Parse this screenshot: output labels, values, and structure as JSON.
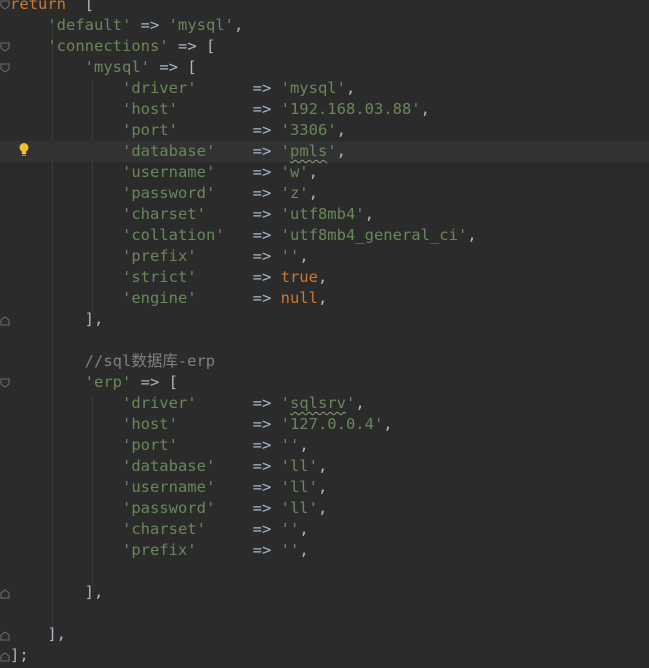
{
  "code_lines": [
    {
      "type": "plain",
      "parts": [
        {
          "c": "kw",
          "t": "return"
        },
        {
          "c": "op",
          "t": "  ["
        }
      ]
    },
    {
      "type": "plain",
      "parts": [
        {
          "c": "op",
          "t": "    "
        },
        {
          "c": "str",
          "t": "'default'"
        },
        {
          "c": "op",
          "t": " => "
        },
        {
          "c": "str",
          "t": "'mysql'"
        },
        {
          "c": "op",
          "t": ","
        }
      ]
    },
    {
      "type": "plain",
      "parts": [
        {
          "c": "op",
          "t": "    "
        },
        {
          "c": "str",
          "t": "'connections'"
        },
        {
          "c": "op",
          "t": " => ["
        }
      ]
    },
    {
      "type": "plain",
      "parts": [
        {
          "c": "op",
          "t": "        "
        },
        {
          "c": "str",
          "t": "'mysql'"
        },
        {
          "c": "op",
          "t": " => ["
        }
      ]
    },
    {
      "type": "plain",
      "parts": [
        {
          "c": "op",
          "t": "            "
        },
        {
          "c": "str",
          "t": "'driver'"
        },
        {
          "c": "op",
          "t": "      => "
        },
        {
          "c": "str",
          "t": "'mysql'"
        },
        {
          "c": "op",
          "t": ","
        }
      ]
    },
    {
      "type": "plain",
      "parts": [
        {
          "c": "op",
          "t": "            "
        },
        {
          "c": "str",
          "t": "'host'"
        },
        {
          "c": "op",
          "t": "        => "
        },
        {
          "c": "str",
          "t": "'192.168.03.88'"
        },
        {
          "c": "op",
          "t": ","
        }
      ]
    },
    {
      "type": "plain",
      "parts": [
        {
          "c": "op",
          "t": "            "
        },
        {
          "c": "str",
          "t": "'port'"
        },
        {
          "c": "op",
          "t": "        => "
        },
        {
          "c": "str",
          "t": "'3306'"
        },
        {
          "c": "op",
          "t": ","
        }
      ]
    },
    {
      "type": "current",
      "parts": [
        {
          "c": "op",
          "t": "            "
        },
        {
          "c": "str",
          "t": "'database'"
        },
        {
          "c": "op",
          "t": "    => "
        },
        {
          "c": "str",
          "t": "'"
        },
        {
          "c": "str squig",
          "t": "pmls"
        },
        {
          "c": "str",
          "t": "'"
        },
        {
          "c": "op",
          "t": ","
        }
      ]
    },
    {
      "type": "plain",
      "parts": [
        {
          "c": "op",
          "t": "            "
        },
        {
          "c": "str",
          "t": "'username'"
        },
        {
          "c": "op",
          "t": "    => "
        },
        {
          "c": "str",
          "t": "'w'"
        },
        {
          "c": "op",
          "t": ","
        }
      ]
    },
    {
      "type": "plain",
      "parts": [
        {
          "c": "op",
          "t": "            "
        },
        {
          "c": "str",
          "t": "'password'"
        },
        {
          "c": "op",
          "t": "    => "
        },
        {
          "c": "str",
          "t": "'z'"
        },
        {
          "c": "op",
          "t": ","
        }
      ]
    },
    {
      "type": "plain",
      "parts": [
        {
          "c": "op",
          "t": "            "
        },
        {
          "c": "str",
          "t": "'charset'"
        },
        {
          "c": "op",
          "t": "     => "
        },
        {
          "c": "str",
          "t": "'utf8mb4'"
        },
        {
          "c": "op",
          "t": ","
        }
      ]
    },
    {
      "type": "plain",
      "parts": [
        {
          "c": "op",
          "t": "            "
        },
        {
          "c": "str",
          "t": "'collation'"
        },
        {
          "c": "op",
          "t": "   => "
        },
        {
          "c": "str",
          "t": "'utf8mb4_general_ci'"
        },
        {
          "c": "op",
          "t": ","
        }
      ]
    },
    {
      "type": "plain",
      "parts": [
        {
          "c": "op",
          "t": "            "
        },
        {
          "c": "str",
          "t": "'prefix'"
        },
        {
          "c": "op",
          "t": "      => "
        },
        {
          "c": "str",
          "t": "''"
        },
        {
          "c": "op",
          "t": ","
        }
      ]
    },
    {
      "type": "plain",
      "parts": [
        {
          "c": "op",
          "t": "            "
        },
        {
          "c": "str",
          "t": "'strict'"
        },
        {
          "c": "op",
          "t": "      => "
        },
        {
          "c": "kw",
          "t": "true"
        },
        {
          "c": "op",
          "t": ","
        }
      ]
    },
    {
      "type": "plain",
      "parts": [
        {
          "c": "op",
          "t": "            "
        },
        {
          "c": "str",
          "t": "'engine'"
        },
        {
          "c": "op",
          "t": "      => "
        },
        {
          "c": "kw",
          "t": "null"
        },
        {
          "c": "op",
          "t": ","
        }
      ]
    },
    {
      "type": "plain",
      "parts": [
        {
          "c": "op",
          "t": "        ],"
        }
      ]
    },
    {
      "type": "plain",
      "parts": [
        {
          "c": "op",
          "t": ""
        }
      ]
    },
    {
      "type": "plain",
      "parts": [
        {
          "c": "op",
          "t": "        "
        },
        {
          "c": "com",
          "t": "//sql数据库-erp"
        }
      ]
    },
    {
      "type": "plain",
      "parts": [
        {
          "c": "op",
          "t": "        "
        },
        {
          "c": "str",
          "t": "'erp'"
        },
        {
          "c": "op",
          "t": " => ["
        }
      ]
    },
    {
      "type": "plain",
      "parts": [
        {
          "c": "op",
          "t": "            "
        },
        {
          "c": "str",
          "t": "'driver'"
        },
        {
          "c": "op",
          "t": "      => "
        },
        {
          "c": "str",
          "t": "'"
        },
        {
          "c": "str squig",
          "t": "sqlsrv"
        },
        {
          "c": "str",
          "t": "'"
        },
        {
          "c": "op",
          "t": ","
        }
      ]
    },
    {
      "type": "plain",
      "parts": [
        {
          "c": "op",
          "t": "            "
        },
        {
          "c": "str",
          "t": "'host'"
        },
        {
          "c": "op",
          "t": "        => "
        },
        {
          "c": "str",
          "t": "'127.0.0.4'"
        },
        {
          "c": "op",
          "t": ","
        }
      ]
    },
    {
      "type": "plain",
      "parts": [
        {
          "c": "op",
          "t": "            "
        },
        {
          "c": "str",
          "t": "'port'"
        },
        {
          "c": "op",
          "t": "        => "
        },
        {
          "c": "str",
          "t": "''"
        },
        {
          "c": "op",
          "t": ","
        }
      ]
    },
    {
      "type": "plain",
      "parts": [
        {
          "c": "op",
          "t": "            "
        },
        {
          "c": "str",
          "t": "'database'"
        },
        {
          "c": "op",
          "t": "    => "
        },
        {
          "c": "str",
          "t": "'ll'"
        },
        {
          "c": "op",
          "t": ","
        }
      ]
    },
    {
      "type": "plain",
      "parts": [
        {
          "c": "op",
          "t": "            "
        },
        {
          "c": "str",
          "t": "'username'"
        },
        {
          "c": "op",
          "t": "    => "
        },
        {
          "c": "str",
          "t": "'ll'"
        },
        {
          "c": "op",
          "t": ","
        }
      ]
    },
    {
      "type": "plain",
      "parts": [
        {
          "c": "op",
          "t": "            "
        },
        {
          "c": "str",
          "t": "'password'"
        },
        {
          "c": "op",
          "t": "    => "
        },
        {
          "c": "str",
          "t": "'ll'"
        },
        {
          "c": "op",
          "t": ","
        }
      ]
    },
    {
      "type": "plain",
      "parts": [
        {
          "c": "op",
          "t": "            "
        },
        {
          "c": "str",
          "t": "'charset'"
        },
        {
          "c": "op",
          "t": "     => "
        },
        {
          "c": "str",
          "t": "''"
        },
        {
          "c": "op",
          "t": ","
        }
      ]
    },
    {
      "type": "plain",
      "parts": [
        {
          "c": "op",
          "t": "            "
        },
        {
          "c": "str",
          "t": "'prefix'"
        },
        {
          "c": "op",
          "t": "      => "
        },
        {
          "c": "str",
          "t": "''"
        },
        {
          "c": "op",
          "t": ","
        }
      ]
    },
    {
      "type": "plain",
      "parts": [
        {
          "c": "op",
          "t": ""
        }
      ]
    },
    {
      "type": "plain",
      "parts": [
        {
          "c": "op",
          "t": "        ],"
        }
      ]
    },
    {
      "type": "plain",
      "parts": [
        {
          "c": "op",
          "t": ""
        }
      ]
    },
    {
      "type": "plain",
      "parts": [
        {
          "c": "op",
          "t": "    ],"
        }
      ]
    },
    {
      "type": "plain",
      "parts": [
        {
          "c": "op",
          "t": "];"
        }
      ]
    }
  ],
  "colors": {
    "background": "#2b2b2b",
    "current_line": "#323232",
    "keyword": "#cc7832",
    "string": "#6a8759",
    "comment": "#808080",
    "text": "#a9b7c6",
    "bulb": "#f0c030"
  },
  "icons": {
    "intention": "lightbulb-icon",
    "fold": "fold-marker-icon"
  }
}
